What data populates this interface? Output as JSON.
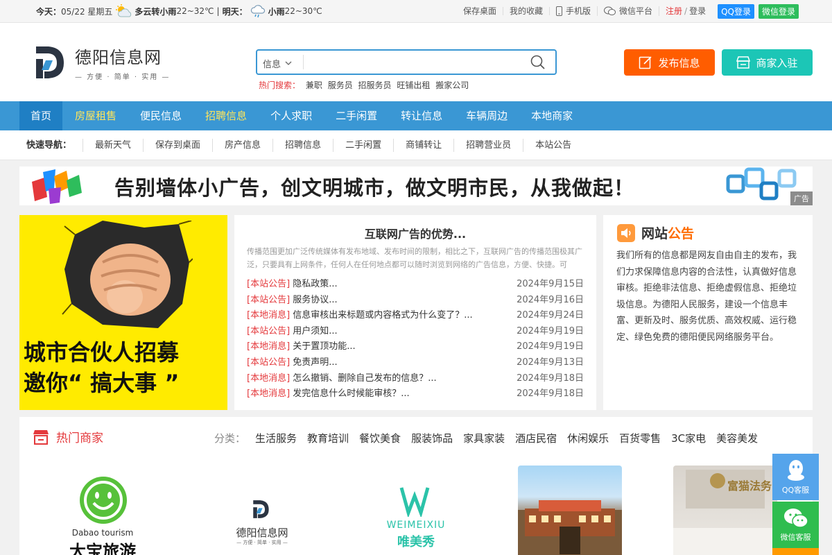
{
  "topbar": {
    "today_label": "今天：",
    "today_date": "05/22 星期五",
    "today_weather": "多云转小雨",
    "today_temp": "22~32℃",
    "divider": "|",
    "tomorrow_label": "明天：",
    "tomorrow_weather": "小雨",
    "tomorrow_temp": "22~30℃",
    "save_desktop": "保存桌面",
    "favorites": "我的收藏",
    "mobile": "手机版",
    "wechat_platform": "微信平台",
    "register": "注册",
    "slash": "/",
    "login": "登录",
    "qq_login": "QQ登录",
    "wechat_login": "微信登录"
  },
  "header": {
    "logo_title": "德阳信息网",
    "logo_sub": "— 方便 · 简单 · 实用 —",
    "search_category": "信息",
    "search_value": "",
    "hot_label": "热门搜索：",
    "hot_terms": [
      "兼职",
      "服务员",
      "招服务员",
      "旺铺出租",
      "搬家公司"
    ],
    "publish_btn": "发布信息",
    "merchant_btn": "商家入驻"
  },
  "nav": [
    "首页",
    "房屋租售",
    "便民信息",
    "招聘信息",
    "个人求职",
    "二手闲置",
    "转让信息",
    "车辆周边",
    "本地商家"
  ],
  "quick_nav": {
    "label": "快速导航：",
    "items": [
      "最新天气",
      "保存到桌面",
      "房产信息",
      "招聘信息",
      "二手闲置",
      "商铺转让",
      "招聘营业员",
      "本站公告"
    ]
  },
  "banner": {
    "text": "告别墙体小广告，创文明城市，做文明市民，从我做起！",
    "ad_tag": "广告"
  },
  "promo": {
    "line1": "城市合伙人招募",
    "line2": "邀你“ 搞大事 ”"
  },
  "news": {
    "title": "互联网广告的优势...",
    "desc": "传播范围更加广泛传统媒体有发布地域、发布时间的限制，相比之下，互联网广告的传播范围极其广泛，只要具有上网条件，任何人在任何地点都可以随时浏览到网络的广告信息，方便、快捷。可",
    "items": [
      {
        "tag": "[本站公告]",
        "title": "隐私政策...",
        "date": "2024年9月15日"
      },
      {
        "tag": "[本站公告]",
        "title": "服务协议...",
        "date": "2024年9月16日"
      },
      {
        "tag": "[本地消息]",
        "title": "信息审核出来标题或内容格式为什么变了？...",
        "date": "2024年9月24日"
      },
      {
        "tag": "[本站公告]",
        "title": "用户须知...",
        "date": "2024年9月19日"
      },
      {
        "tag": "[本地消息]",
        "title": "关于置顶功能...",
        "date": "2024年9月19日"
      },
      {
        "tag": "[本站公告]",
        "title": "免责声明...",
        "date": "2024年9月13日"
      },
      {
        "tag": "[本地消息]",
        "title": "怎么撤销、删除自己发布的信息？...",
        "date": "2024年9月18日"
      },
      {
        "tag": "[本地消息]",
        "title": "发完信息什么时候能审核？...",
        "date": "2024年9月18日"
      }
    ]
  },
  "notice": {
    "title_a": "网站",
    "title_b": "公告",
    "body": "我们所有的信息都是网友自由自主的发布，我们力求保障信息内容的合法性，认真做好信息审核。拒绝非法信息、拒绝虚假信息、拒绝垃圾信息。为德阳人民服务，建设一个信息丰富、更新及时、服务优质、高效权威、运行稳定、绿色免费的德阳便民网络服务平台。"
  },
  "merchants": {
    "title": "热门商家",
    "cat_label": "分类：",
    "categories": [
      "生活服务",
      "教育培训",
      "餐饮美食",
      "服装饰品",
      "家具家装",
      "酒店民宿",
      "休闲娱乐",
      "百货零售",
      "3C家电",
      "美容美发"
    ],
    "cards": [
      {
        "en": "Dabao tourism",
        "cn": "大宝旅游"
      },
      {
        "cn": "德阳信息网",
        "sub": "— 方便 · 简单 · 实用 —"
      },
      {
        "en": "WEIMEIXIU",
        "cn": "唯美秀"
      },
      {},
      {
        "cn": "富猫法务"
      }
    ]
  },
  "side": {
    "qq": "QQ客服",
    "wechat": "微信客服"
  }
}
